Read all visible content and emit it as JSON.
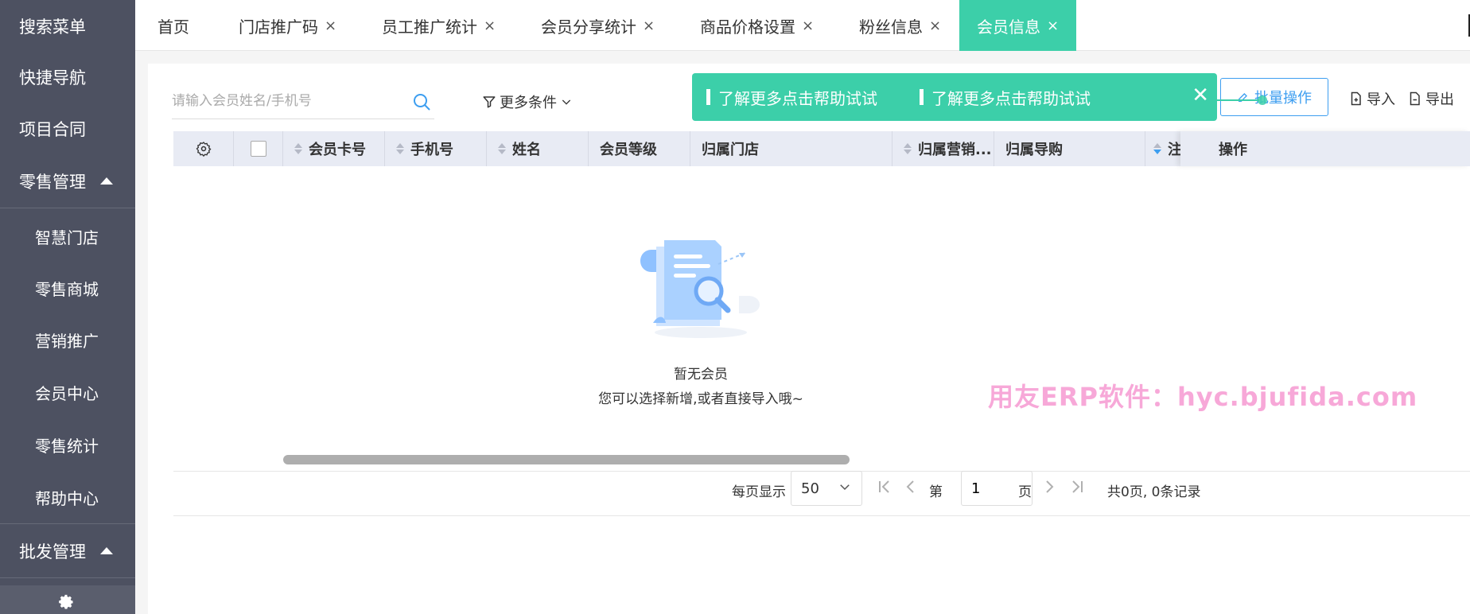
{
  "sidebar": {
    "items": [
      {
        "label": "搜索菜单"
      },
      {
        "label": "快捷导航"
      },
      {
        "label": "项目合同"
      },
      {
        "label": "零售管理"
      },
      {
        "label": "智慧门店"
      },
      {
        "label": "零售商城"
      },
      {
        "label": "营销推广"
      },
      {
        "label": "会员中心"
      },
      {
        "label": "零售统计"
      },
      {
        "label": "帮助中心"
      },
      {
        "label": "批发管理"
      }
    ]
  },
  "tabs": [
    {
      "label": "首页"
    },
    {
      "label": "门店推广码",
      "close": "×"
    },
    {
      "label": "员工推广统计",
      "close": "×"
    },
    {
      "label": "会员分享统计",
      "close": "×"
    },
    {
      "label": "商品价格设置",
      "close": "×"
    },
    {
      "label": "粉丝信息",
      "close": "×"
    },
    {
      "label": "会员信息",
      "close": "×",
      "active": true
    }
  ],
  "toolbar": {
    "search_placeholder": "请输入会员姓名/手机号",
    "more_conditions": "更多条件",
    "batch_operation": "批量操作",
    "import": "导入",
    "export": "导出"
  },
  "help_banner": {
    "tip1": "了解更多点击帮助试试",
    "tip2": "了解更多点击帮助试试",
    "close": "✕"
  },
  "table": {
    "columns": [
      "会员卡号",
      "手机号",
      "姓名",
      "会员等级",
      "归属门店",
      "归属营销...",
      "归属导购",
      "注",
      "操作"
    ]
  },
  "empty_state": {
    "title": "暂无会员",
    "subtitle": "您可以选择新增,或者直接导入哦~"
  },
  "watermark": "用友ERP软件：hyc.bjufida.com",
  "pagination": {
    "per_page_label": "每页显示",
    "per_page_value": "50",
    "page_prefix": "第",
    "page_value": "1",
    "page_suffix": "页",
    "summary": "共0页, 0条记录"
  },
  "colors": {
    "sidebar_bg": "#4d5161",
    "accent": "#3ccfa9",
    "primary_blue": "#3d9ef0",
    "header_bg": "#e8ebf4"
  }
}
